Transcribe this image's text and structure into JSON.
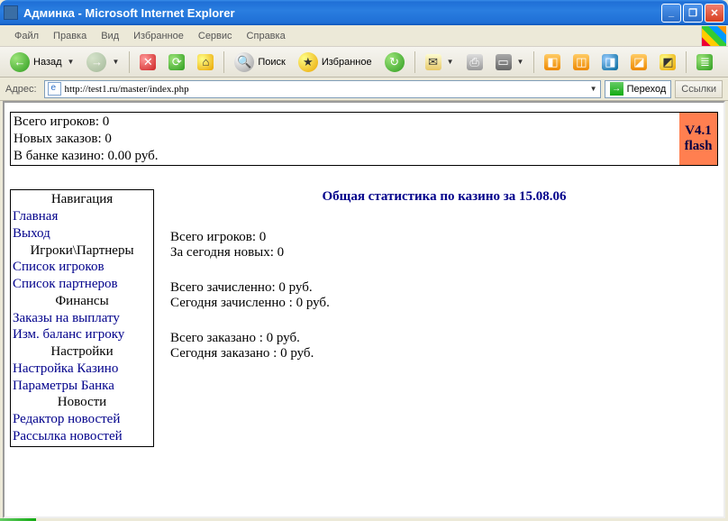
{
  "window": {
    "title": "Админка - Microsoft Internet Explorer"
  },
  "menus": [
    "Файл",
    "Правка",
    "Вид",
    "Избранное",
    "Сервис",
    "Справка"
  ],
  "toolbar": {
    "back": "Назад",
    "search": "Поиск",
    "favorites": "Избранное"
  },
  "address": {
    "label": "Адрес:",
    "url": "http://test1.ru/master/index.php",
    "go": "Переход",
    "links": "Ссылки"
  },
  "summary": {
    "players_label": "Всего игроков:",
    "players_value": "0",
    "orders_label": "Новых заказов:",
    "orders_value": "0",
    "bank_label": "В банке казино:",
    "bank_value": "0.00 руб."
  },
  "version": {
    "line1": "V4.1",
    "line2": "flash"
  },
  "nav": {
    "heading1": "Навигация",
    "home": "Главная",
    "exit": "Выход",
    "heading2": "Игроки\\Партнеры",
    "players_list": "Список игроков",
    "partners_list": "Список партнеров",
    "heading3": "Финансы",
    "payouts": "Заказы на выплату",
    "balance": "Изм. баланс игроку",
    "heading4": "Настройки",
    "casino_settings": "Настройка Казино",
    "bank_params": "Параметры Банка",
    "heading5": "Новости",
    "news_editor": "Редактор новостей",
    "news_mail": "Рассылка новостей"
  },
  "main": {
    "title": "Общая статистика по казино за 15.08.06",
    "stats": {
      "total_players": "Всего игроков: 0",
      "new_today": "За сегодня новых: 0",
      "credited_total": "Всего зачисленно: 0 руб.",
      "credited_today": "Сегодня зачисленно : 0 руб.",
      "ordered_total": "Всего заказано : 0 руб.",
      "ordered_today": "Сегодня заказано : 0 руб."
    }
  }
}
